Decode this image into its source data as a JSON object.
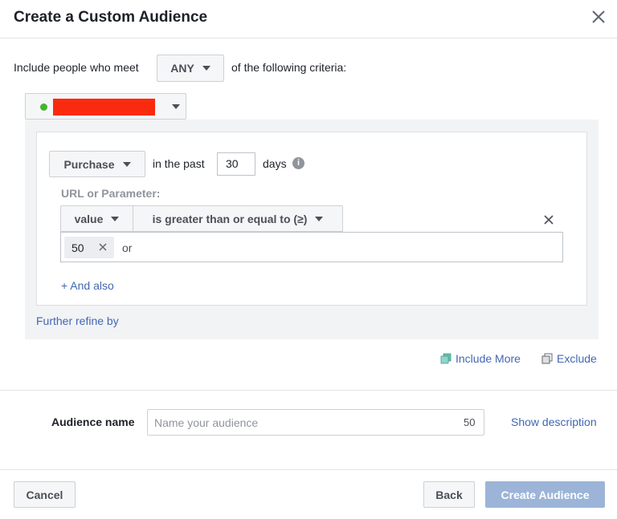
{
  "dialog": {
    "title": "Create a Custom Audience"
  },
  "criteria": {
    "prefix": "Include people who meet",
    "match_mode": "ANY",
    "suffix": "of the following criteria:"
  },
  "source": {
    "status_color": "#42b72a",
    "name_redacted": true
  },
  "rule": {
    "event": "Purchase",
    "in_the_past_label": "in the past",
    "days_value": "30",
    "days_label": "days",
    "info_icon": "info-icon",
    "url_param_label": "URL or Parameter:",
    "parameter": "value",
    "operator": "is greater than or equal to (≥)",
    "tokens": [
      "50"
    ],
    "or_label": "or",
    "and_also": "+ And also"
  },
  "further_refine": "Further refine by",
  "actions": {
    "include_more": "Include More",
    "exclude": "Exclude"
  },
  "audience_name": {
    "label": "Audience name",
    "placeholder": "Name your audience",
    "value": "",
    "char_count": "50",
    "show_description": "Show description"
  },
  "footer": {
    "cancel": "Cancel",
    "back": "Back",
    "create": "Create Audience"
  },
  "colors": {
    "link": "#4267b2",
    "primary_disabled": "#9cb4d8",
    "redaction": "#fa2a0f"
  }
}
